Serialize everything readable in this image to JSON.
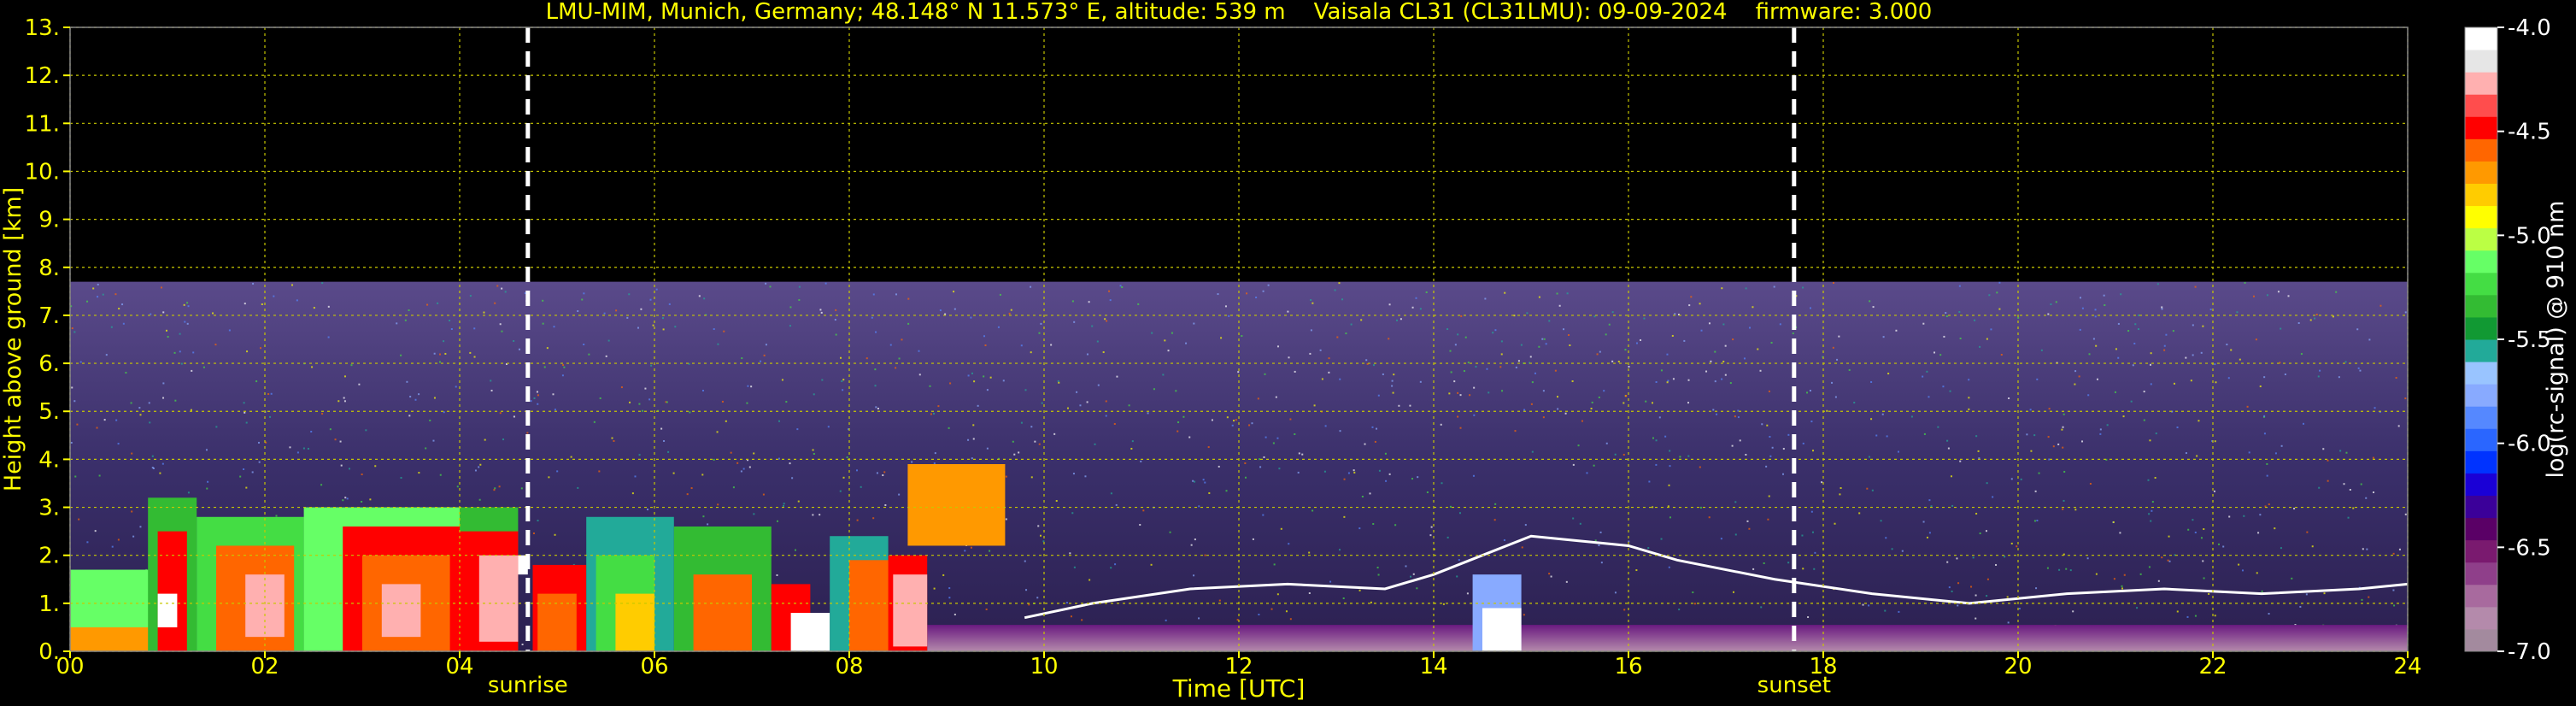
{
  "chart_data": {
    "type": "heatmap",
    "title": "LMU-MIM, Munich, Germany; 48.148° N 11.573° E, altitude: 539 m    Vaisala CL31 (CL31LMU): 09-09-2024    firmware: 3.000",
    "xlabel": "Time [UTC]",
    "ylabel": "Height above ground [km]",
    "xlim": [
      0,
      24
    ],
    "ylim": [
      0,
      13
    ],
    "x_ticks": [
      "00",
      "02",
      "04",
      "06",
      "08",
      "10",
      "12",
      "14",
      "16",
      "18",
      "20",
      "22",
      "24"
    ],
    "y_ticks": [
      "0.",
      "1.",
      "2.",
      "3.",
      "4.",
      "5.",
      "6.",
      "7.",
      "8.",
      "9.",
      "10.",
      "11.",
      "12.",
      "13."
    ],
    "grid": true,
    "markers": [
      {
        "label": "sunrise",
        "x": 4.7
      },
      {
        "label": "sunset",
        "x": 17.7
      }
    ],
    "signal_top_km": 7.7,
    "colorbar": {
      "label": "log(rc-signal) @ 910 nm",
      "range": [
        -7.0,
        -4.0
      ],
      "ticks": [
        "-4.0",
        "-4.5",
        "-5.0",
        "-5.5",
        "-6.0",
        "-6.5",
        "-7.0"
      ],
      "colors": [
        "#a38a9e",
        "#b48aab",
        "#a86a9e",
        "#8f3f8a",
        "#7a1a6f",
        "#5a0066",
        "#3b0099",
        "#1a00d6",
        "#0033ff",
        "#2a66ff",
        "#5588ff",
        "#88aaff",
        "#99c4ff",
        "#22aa99",
        "#119933",
        "#33bb33",
        "#44dd44",
        "#66ff66",
        "#bbff44",
        "#ffff00",
        "#ffcc00",
        "#ff9900",
        "#ff6600",
        "#ff0000",
        "#ff4d4d",
        "#ffb0b0",
        "#e6e6e6",
        "#ffffff"
      ]
    },
    "colors": {
      "text_accent": "#ffff00",
      "grid": "#c8c800",
      "background": "#000000",
      "marker_line": "#ffffff"
    }
  }
}
